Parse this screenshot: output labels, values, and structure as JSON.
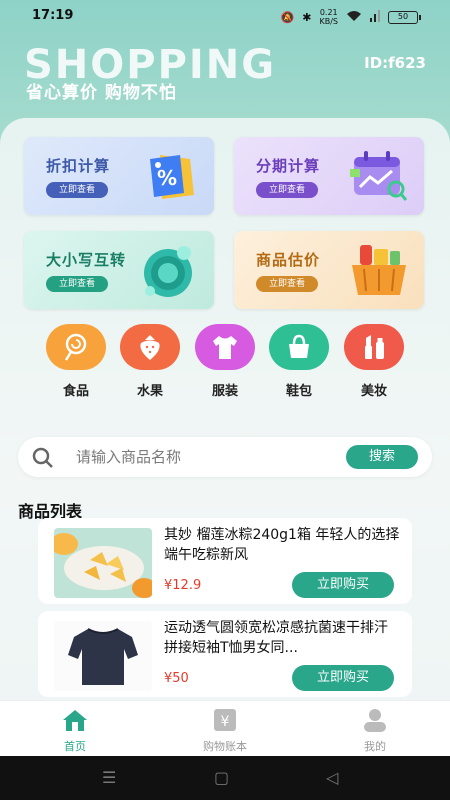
{
  "status_bar": {
    "time": "17:19",
    "network_speed": "0.21",
    "network_unit": "KB/S",
    "battery": "50"
  },
  "header": {
    "brand": "SHOPPING",
    "slogan": "省心算价  购物不怕",
    "user_id": "ID:f623"
  },
  "tools": [
    {
      "title": "折扣计算",
      "button": "立即查看",
      "icon": "discount-tag-icon"
    },
    {
      "title": "分期计算",
      "button": "立即查看",
      "icon": "calendar-chart-icon"
    },
    {
      "title": "大小写互转",
      "button": "立即查看",
      "icon": "coin-icon"
    },
    {
      "title": "商品估价",
      "button": "立即查看",
      "icon": "shopping-basket-icon"
    }
  ],
  "categories": [
    {
      "label": "食品",
      "icon": "lollipop-icon",
      "color": "#f7a23a"
    },
    {
      "label": "水果",
      "icon": "strawberry-icon",
      "color": "#f36b43"
    },
    {
      "label": "服装",
      "icon": "shirt-icon",
      "color": "#d65be0"
    },
    {
      "label": "鞋包",
      "icon": "handbag-icon",
      "color": "#2fbf95"
    },
    {
      "label": "美妆",
      "icon": "lipstick-icon",
      "color": "#f05a4b"
    }
  ],
  "search": {
    "placeholder": "请输入商品名称",
    "button": "搜索"
  },
  "product_section_title": "商品列表",
  "products": [
    {
      "name": "其妙 榴莲冰粽240g1箱 年轻人的选择 端午吃粽新风",
      "price": "¥12.9",
      "button": "立即购买"
    },
    {
      "name": "运动透气圆领宽松凉感抗菌速干排汗拼接短袖T恤男女同...",
      "price": "¥50",
      "button": "立即购买"
    }
  ],
  "tabbar": [
    {
      "label": "首页",
      "icon": "home-icon",
      "active": true
    },
    {
      "label": "购物账本",
      "icon": "ledger-icon",
      "active": false
    },
    {
      "label": "我的",
      "icon": "user-icon",
      "active": false
    }
  ],
  "colors": {
    "accent": "#2aa68a",
    "price": "#e23b2e",
    "header_bg": "#8ed2c7"
  }
}
